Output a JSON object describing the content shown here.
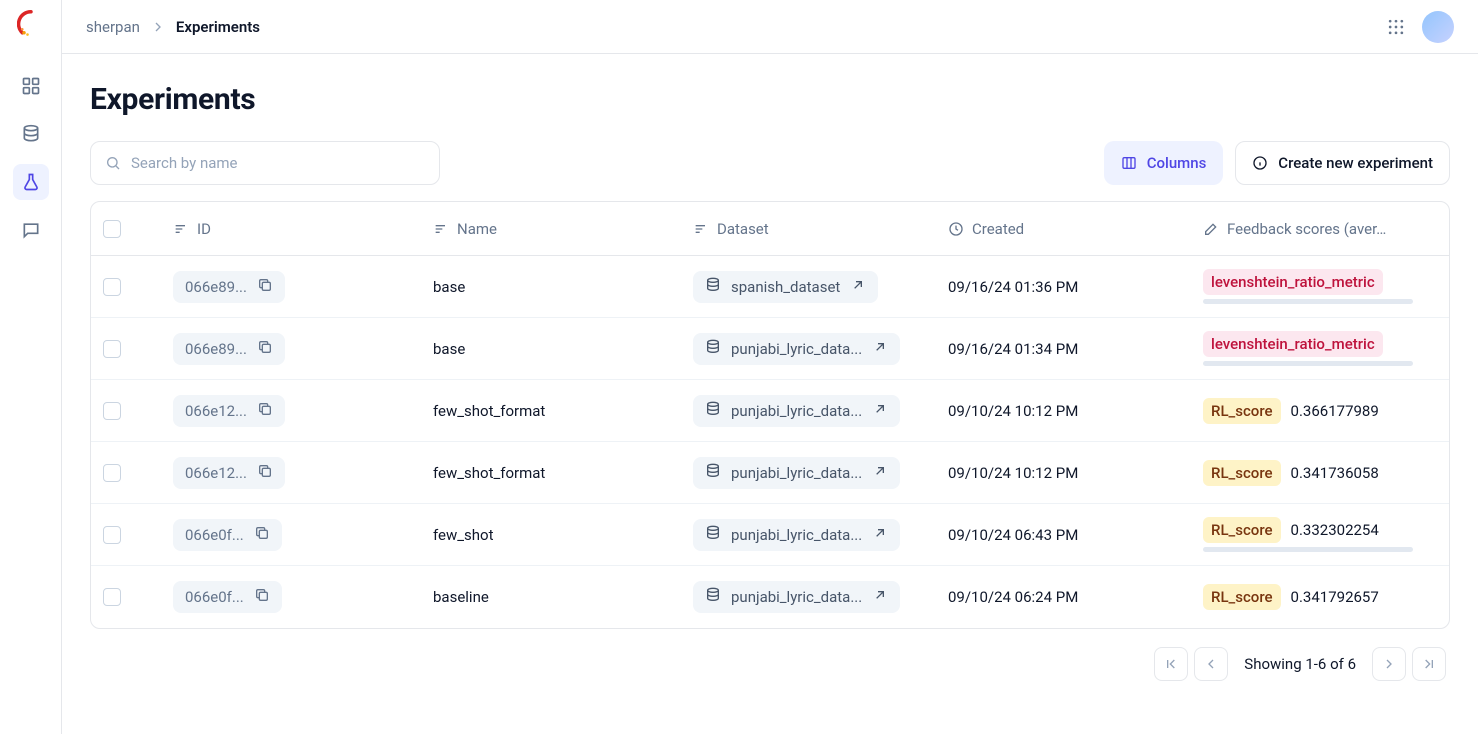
{
  "breadcrumb": {
    "root": "sherpan",
    "leaf": "Experiments"
  },
  "sidebar": {
    "items": [
      "dashboard",
      "database",
      "experiments",
      "chat"
    ],
    "active": 2
  },
  "page": {
    "title": "Experiments"
  },
  "search": {
    "placeholder": "Search by name"
  },
  "buttons": {
    "columns": "Columns",
    "create": "Create new experiment"
  },
  "table": {
    "columns": [
      "",
      "ID",
      "Name",
      "Dataset",
      "Created",
      "Feedback scores (aver…"
    ],
    "rows": [
      {
        "id": "066e89...",
        "name": "base",
        "dataset": "spanish_dataset",
        "created": "09/16/24 01:36 PM",
        "metric_type": "pink",
        "metric_label": "levenshtein_ratio_metric",
        "value": "",
        "show_bar": true
      },
      {
        "id": "066e89...",
        "name": "base",
        "dataset": "punjabi_lyric_data...",
        "created": "09/16/24 01:34 PM",
        "metric_type": "pink",
        "metric_label": "levenshtein_ratio_metric",
        "value": "",
        "show_bar": true
      },
      {
        "id": "066e12...",
        "name": "few_shot_format",
        "dataset": "punjabi_lyric_data...",
        "created": "09/10/24 10:12 PM",
        "metric_type": "yellow",
        "metric_label": "RL_score",
        "value": "0.366177989",
        "show_bar": false
      },
      {
        "id": "066e12...",
        "name": "few_shot_format",
        "dataset": "punjabi_lyric_data...",
        "created": "09/10/24 10:12 PM",
        "metric_type": "yellow",
        "metric_label": "RL_score",
        "value": "0.341736058",
        "show_bar": false
      },
      {
        "id": "066e0f...",
        "name": "few_shot",
        "dataset": "punjabi_lyric_data...",
        "created": "09/10/24 06:43 PM",
        "metric_type": "yellow",
        "metric_label": "RL_score",
        "value": "0.332302254",
        "show_bar": true
      },
      {
        "id": "066e0f...",
        "name": "baseline",
        "dataset": "punjabi_lyric_data...",
        "created": "09/10/24 06:24 PM",
        "metric_type": "yellow",
        "metric_label": "RL_score",
        "value": "0.341792657",
        "show_bar": false
      }
    ]
  },
  "pagination": {
    "text": "Showing 1-6 of 6"
  }
}
